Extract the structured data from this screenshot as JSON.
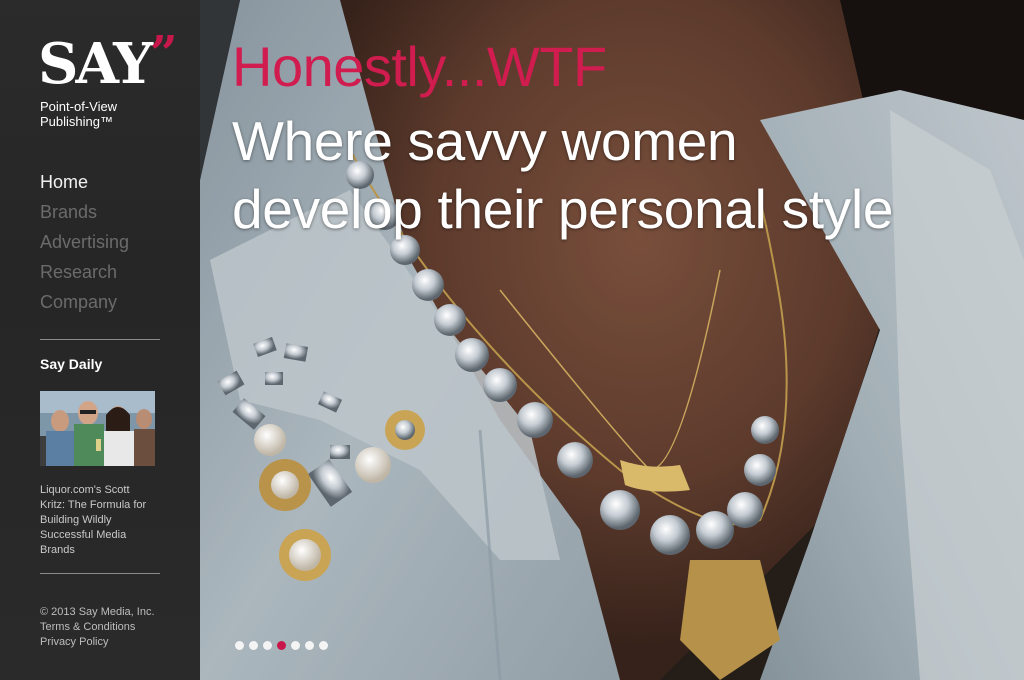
{
  "brand": {
    "logo_text": "SAY",
    "logo_mark": "”",
    "tagline_line1": "Point-of-View",
    "tagline_line2": "Publishing™",
    "accent_color": "#c8174a"
  },
  "nav": {
    "items": [
      {
        "label": "Home",
        "active": true
      },
      {
        "label": "Brands",
        "active": false
      },
      {
        "label": "Advertising",
        "active": false
      },
      {
        "label": "Research",
        "active": false
      },
      {
        "label": "Company",
        "active": false
      }
    ]
  },
  "say_daily": {
    "title": "Say Daily",
    "caption": "Liquor.com's Scott Kritz: The Formula for Building Wildly Successful Media Brands"
  },
  "footer": {
    "copyright": "© 2013 Say Media, Inc.",
    "terms": "Terms & Conditions",
    "privacy": "Privacy Policy"
  },
  "hero": {
    "kicker": "Honestly...WTF",
    "headline_line1": "Where savvy women",
    "headline_line2": "develop their personal style",
    "kicker_color": "#d01c4e",
    "slides_total": 7,
    "slide_active_index": 3
  }
}
